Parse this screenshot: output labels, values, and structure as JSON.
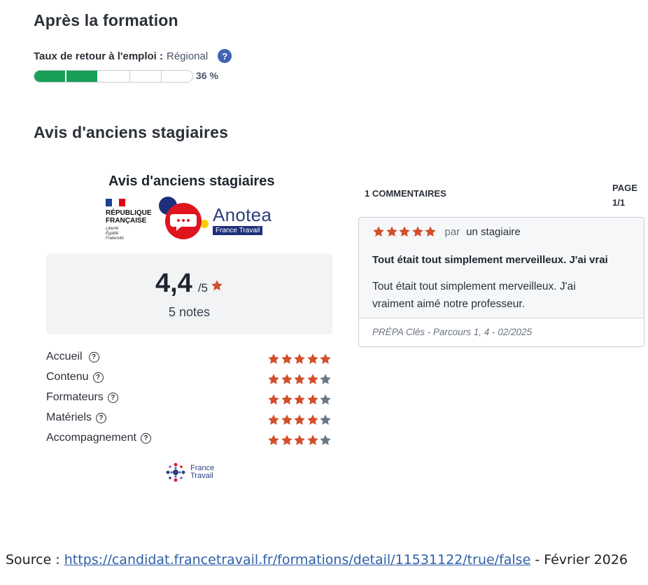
{
  "sections": {
    "after_training_title": "Après la formation",
    "reviews_title": "Avis d'anciens stagiaires"
  },
  "employment": {
    "label": "Taux de retour à l'emploi :",
    "scope": "Régional",
    "help_icon": "?",
    "percent_text": "36 %",
    "filled_segments": 2,
    "total_segments": 5,
    "colors": {
      "filled": "#18a058",
      "empty": "#ffffff"
    }
  },
  "widget": {
    "title": "Avis d'anciens stagiaires",
    "rf_logo": {
      "line1": "RÉPUBLIQUE",
      "line2": "FRANÇAISE",
      "motto": [
        "Liberté",
        "Égalité",
        "Fraternité"
      ]
    },
    "anotea_logo": {
      "name": "Anotea",
      "subtitle": "France Travail"
    },
    "score": "4,4",
    "score_max": "/5",
    "notes_count": "5 notes",
    "criteria": [
      {
        "label": "Accueil",
        "rating": 5
      },
      {
        "label": "Contenu",
        "rating": 4
      },
      {
        "label": "Formateurs",
        "rating": 4
      },
      {
        "label": "Matériels",
        "rating": 4
      },
      {
        "label": "Accompagnement",
        "rating": 4
      }
    ],
    "footer_logo": {
      "line1": "France",
      "line2": "Travail"
    },
    "colors": {
      "star_filled": "#d24f2b",
      "star_empty": "#6b7785"
    }
  },
  "comments": {
    "count_label": "1 COMMENTAIRES",
    "page_label": "PAGE",
    "page_value": "1/1",
    "items": [
      {
        "rating": 5,
        "par": "par",
        "author": "un stagiaire",
        "title": "Tout était tout simplement merveilleux. J'ai vrai",
        "text": "Tout était tout simplement merveilleux. J'ai vraiment aimé notre professeur.",
        "formation": "PRÉPA Clés - Parcours 1, 4 - 02/2025"
      }
    ]
  },
  "source": {
    "prefix": "Source : ",
    "url": "https://candidat.francetravail.fr/formations/detail/11531122/true/false",
    "suffix": " - Février 2026"
  }
}
